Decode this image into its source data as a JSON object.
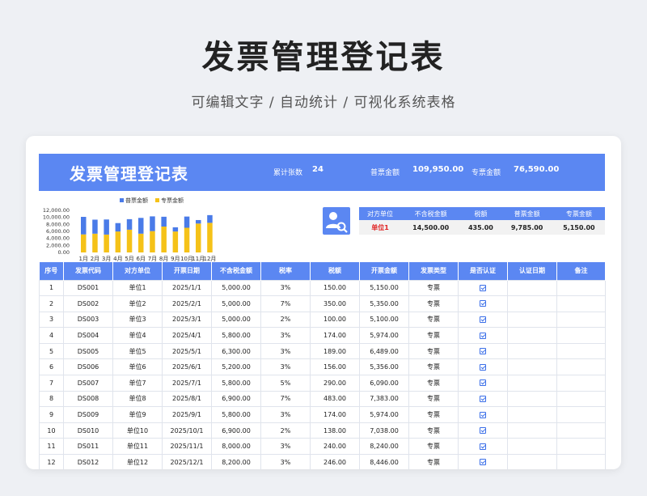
{
  "title": "发票管理登记表",
  "subtitle": "可编辑文字 / 自动统计 / 可视化系统表格",
  "banner": {
    "title": "发票管理登记表",
    "count_label": "累计张数",
    "count_value": "24",
    "normal_label": "普票金额",
    "normal_value": "109,950.00",
    "special_label": "专票金额",
    "special_value": "76,590.00"
  },
  "summary": {
    "headers": [
      "对方单位",
      "不含税金额",
      "税额",
      "普票金额",
      "专票金额"
    ],
    "row": [
      "单位1",
      "14,500.00",
      "435.00",
      "9,785.00",
      "5,150.00"
    ]
  },
  "icons": {
    "user_search": "user-search-icon",
    "check": "checkbox-icon"
  },
  "colors": {
    "accent": "#5b87f2",
    "bar_blue": "#4a7be8",
    "bar_yellow": "#f5c218",
    "highlight": "#e02020"
  },
  "chart_data": {
    "type": "bar",
    "stacked": true,
    "categories": [
      "1月",
      "2月",
      "3月",
      "4月",
      "5月",
      "6月",
      "7月",
      "8月",
      "9月",
      "10月",
      "11月",
      "12月"
    ],
    "series": [
      {
        "name": "普票金额",
        "values": [
          5000,
          4000,
          4300,
          2400,
          3000,
          4500,
          4200,
          2800,
          1200,
          3200,
          1000,
          2200
        ]
      },
      {
        "name": "专票金额",
        "values": [
          5150,
          5350,
          5100,
          5974,
          6489,
          5356,
          6090,
          7383,
          5974,
          7038,
          8240,
          8446
        ]
      }
    ],
    "yticks": [
      "12,000.00",
      "10,000.00",
      "8,000.00",
      "6,000.00",
      "4,000.00",
      "2,000.00",
      "0.00"
    ],
    "ylim": [
      0,
      12000
    ],
    "legend_position": "top"
  },
  "table": {
    "headers": [
      "序号",
      "发票代码",
      "对方单位",
      "开票日期",
      "不含税金额",
      "税率",
      "税额",
      "开票金额",
      "发票类型",
      "是否认证",
      "认证日期",
      "备注"
    ],
    "rows": [
      [
        "1",
        "DS001",
        "单位1",
        "2025/1/1",
        "5,000.00",
        "3%",
        "150.00",
        "5,150.00",
        "专票"
      ],
      [
        "2",
        "DS002",
        "单位2",
        "2025/2/1",
        "5,000.00",
        "7%",
        "350.00",
        "5,350.00",
        "专票"
      ],
      [
        "3",
        "DS003",
        "单位3",
        "2025/3/1",
        "5,000.00",
        "2%",
        "100.00",
        "5,100.00",
        "专票"
      ],
      [
        "4",
        "DS004",
        "单位4",
        "2025/4/1",
        "5,800.00",
        "3%",
        "174.00",
        "5,974.00",
        "专票"
      ],
      [
        "5",
        "DS005",
        "单位5",
        "2025/5/1",
        "6,300.00",
        "3%",
        "189.00",
        "6,489.00",
        "专票"
      ],
      [
        "6",
        "DS006",
        "单位6",
        "2025/6/1",
        "5,200.00",
        "3%",
        "156.00",
        "5,356.00",
        "专票"
      ],
      [
        "7",
        "DS007",
        "单位7",
        "2025/7/1",
        "5,800.00",
        "5%",
        "290.00",
        "6,090.00",
        "专票"
      ],
      [
        "8",
        "DS008",
        "单位8",
        "2025/8/1",
        "6,900.00",
        "7%",
        "483.00",
        "7,383.00",
        "专票"
      ],
      [
        "9",
        "DS009",
        "单位9",
        "2025/9/1",
        "5,800.00",
        "3%",
        "174.00",
        "5,974.00",
        "专票"
      ],
      [
        "10",
        "DS010",
        "单位10",
        "2025/10/1",
        "6,900.00",
        "2%",
        "138.00",
        "7,038.00",
        "专票"
      ],
      [
        "11",
        "DS011",
        "单位11",
        "2025/11/1",
        "8,000.00",
        "3%",
        "240.00",
        "8,240.00",
        "专票"
      ],
      [
        "12",
        "DS012",
        "单位12",
        "2025/12/1",
        "8,200.00",
        "3%",
        "246.00",
        "8,446.00",
        "专票"
      ]
    ]
  }
}
